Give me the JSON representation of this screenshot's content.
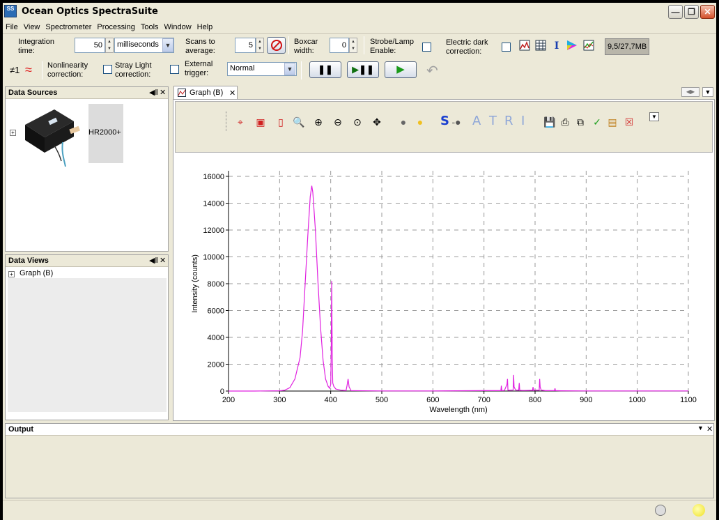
{
  "window": {
    "title": "Ocean Optics SpectraSuite",
    "app_icon_text": "SS",
    "controls": [
      "minimize-icon",
      "maximize-icon",
      "close-icon"
    ]
  },
  "menu": [
    "File",
    "View",
    "Spectrometer",
    "Processing",
    "Tools",
    "Window",
    "Help"
  ],
  "toolbar": {
    "integration_label_1": "Integration",
    "integration_label_2": "time:",
    "integration_value": "50",
    "integration_unit": "milliseconds",
    "scans_label_1": "Scans to",
    "scans_label_2": "average:",
    "scans_value": "5",
    "boxcar_label_1": "Boxcar",
    "boxcar_label_2": "width:",
    "boxcar_value": "0",
    "strobe_label_1": "Strobe/Lamp",
    "strobe_label_2": "Enable:",
    "dark_label_1": "Electric dark",
    "dark_label_2": "correction:",
    "memory": "9,5/27,7MB",
    "spectrometer_index": "≠1",
    "nonlinearity_label_1": "Nonlinearity",
    "nonlinearity_label_2": "correction:",
    "stray_label_1": "Stray Light",
    "stray_label_2": "correction:",
    "trigger_label_1": "External",
    "trigger_label_2": "trigger:",
    "trigger_value": "Normal"
  },
  "data_sources": {
    "title": "Data Sources",
    "device_name": "HR2000+"
  },
  "data_views": {
    "title": "Data Views",
    "item": "Graph (B)"
  },
  "graph": {
    "tab_label": "Graph (B)",
    "letters": [
      "S",
      "A",
      "T",
      "R",
      "I"
    ]
  },
  "output": {
    "title": "Output"
  },
  "colors": {
    "spectrum": "#e020e0",
    "accent_blue": "#2255cc",
    "letters_faded": "#8fa7d8"
  },
  "chart_data": {
    "type": "line",
    "xlabel": "Wavelength (nm)",
    "ylabel": "Intensity (counts)",
    "xlim": [
      200,
      1100
    ],
    "ylim": [
      0,
      16000
    ],
    "xticks": [
      200,
      300,
      400,
      500,
      600,
      700,
      800,
      900,
      1000,
      1100
    ],
    "yticks": [
      0,
      2000,
      4000,
      6000,
      8000,
      10000,
      12000,
      14000,
      16000
    ],
    "grid": true,
    "series": [
      {
        "x": [
          200,
          250,
          300,
          310,
          320,
          330,
          340,
          345,
          350,
          355,
          360,
          363,
          365,
          370,
          375,
          380,
          385,
          390,
          395,
          398,
          400,
          401,
          402,
          403,
          404,
          406,
          410,
          420,
          430,
          432,
          434,
          436,
          440,
          500,
          600,
          700,
          733,
          734,
          735,
          740,
          745,
          746,
          747,
          750,
          757,
          758,
          759,
          762,
          768,
          769,
          770,
          775,
          780,
          795,
          796,
          797,
          800,
          808,
          809,
          810,
          812,
          820,
          838,
          839,
          840,
          850,
          900,
          1000,
          1100
        ],
        "y": [
          0,
          0,
          20,
          60,
          250,
          900,
          2500,
          4500,
          8000,
          11500,
          14500,
          15300,
          14800,
          12000,
          8200,
          4800,
          2300,
          900,
          350,
          200,
          500,
          3000,
          8200,
          2500,
          600,
          350,
          150,
          60,
          40,
          400,
          900,
          300,
          30,
          10,
          10,
          30,
          30,
          400,
          30,
          40,
          500,
          900,
          50,
          60,
          80,
          1200,
          300,
          80,
          60,
          600,
          50,
          40,
          40,
          50,
          300,
          40,
          80,
          50,
          900,
          300,
          70,
          30,
          30,
          200,
          30,
          20,
          10,
          10,
          10
        ]
      }
    ]
  }
}
